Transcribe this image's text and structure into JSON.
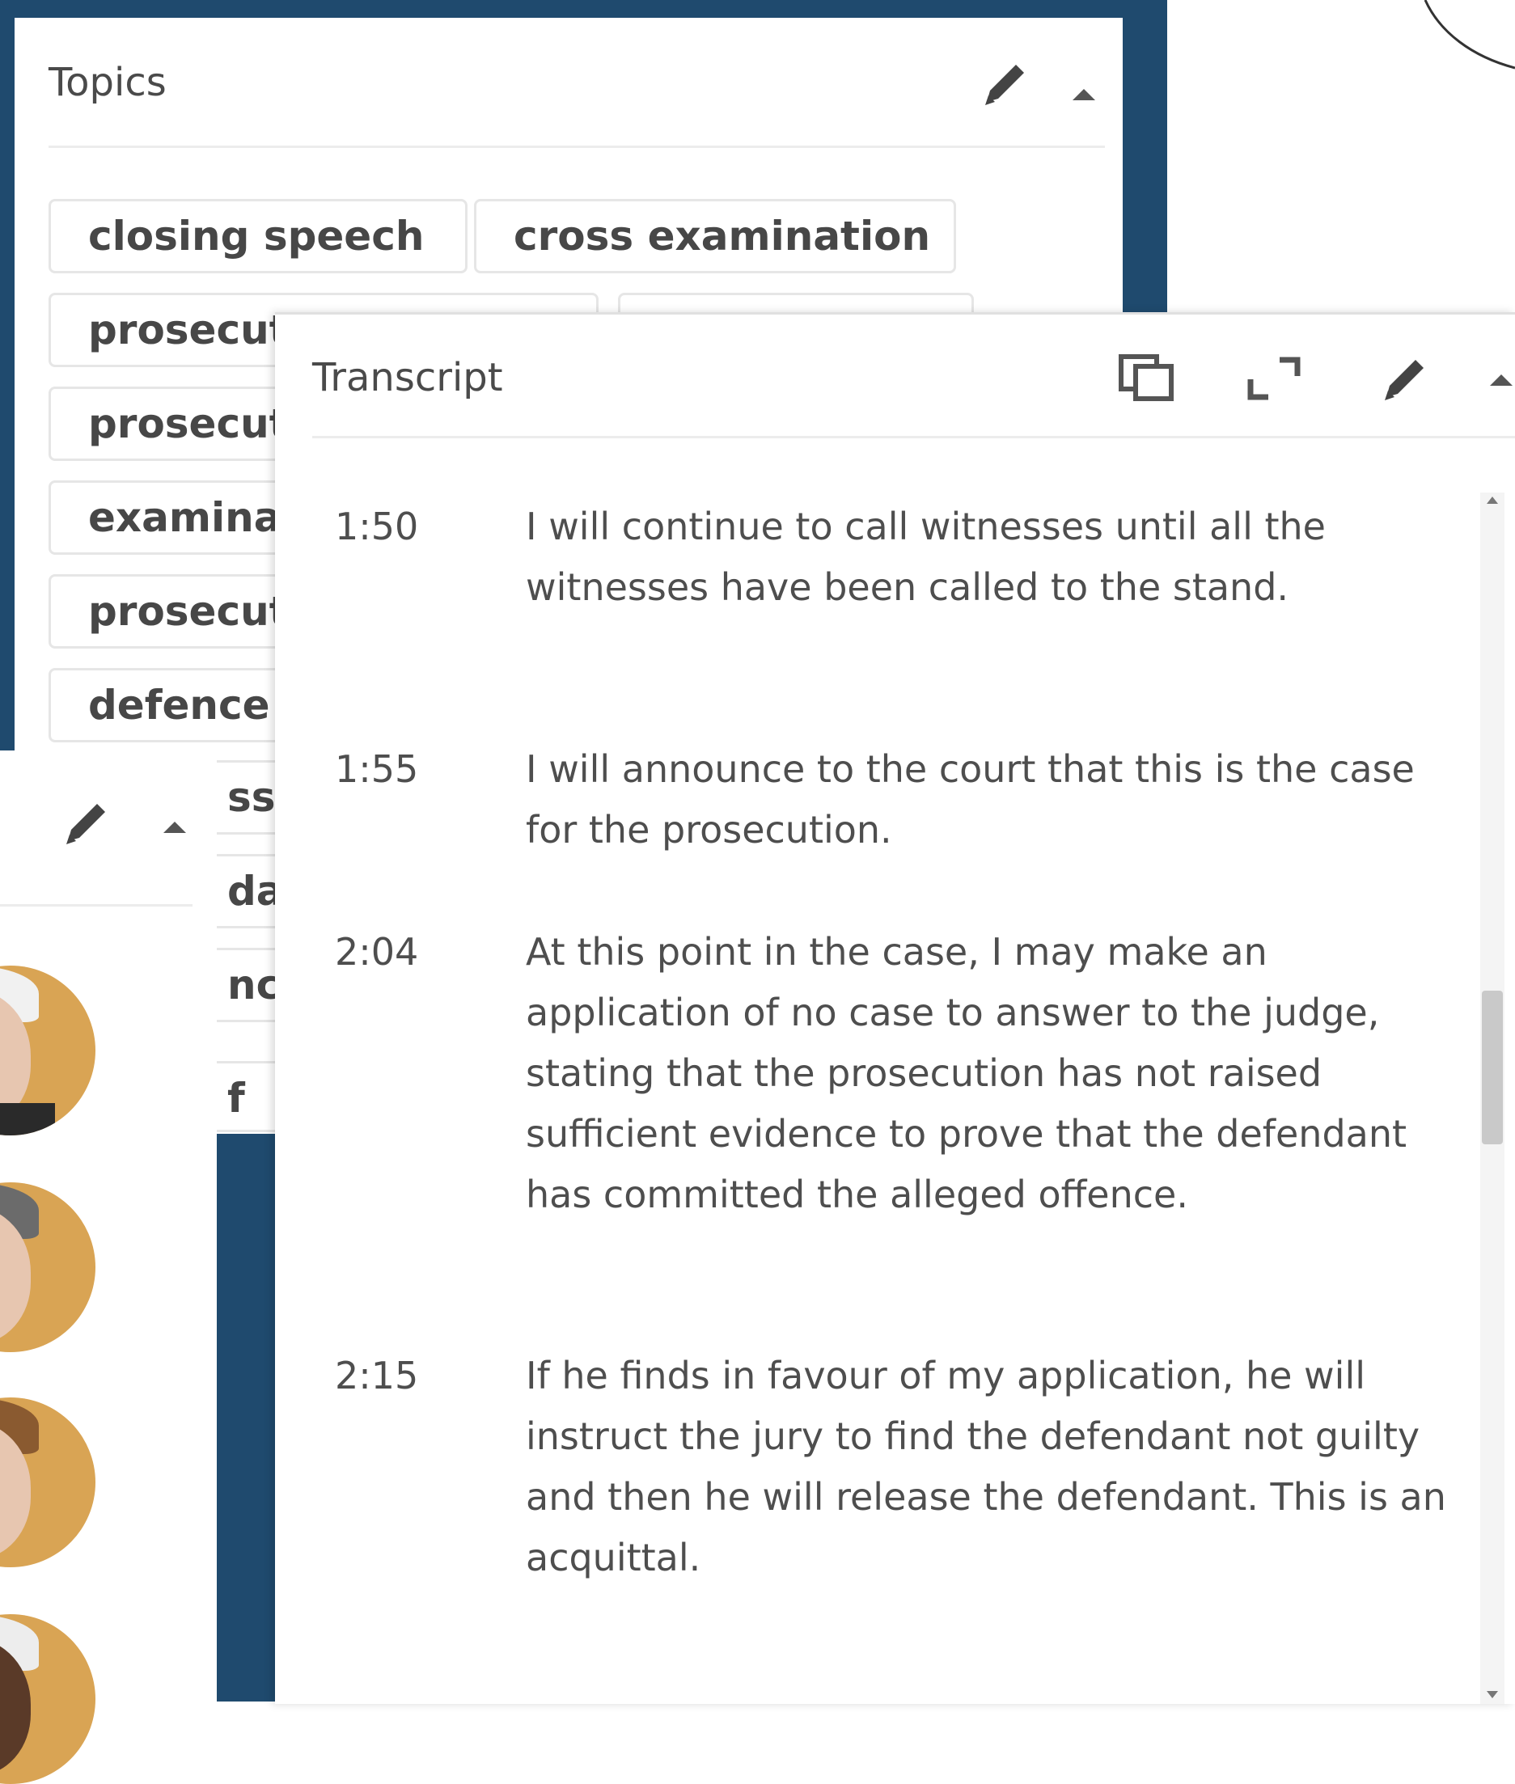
{
  "colors": {
    "frame": "#1f4a6e",
    "panel": "#ffffff",
    "chip_border": "#e6e6e6",
    "text": "#4a4a4a"
  },
  "topics_panel": {
    "title": "Topics",
    "icons": [
      "pencil-icon",
      "collapse-icon"
    ],
    "chips": [
      "closing speech",
      "cross examination",
      "prosecut",
      "prosecut",
      "examina",
      "prosecut",
      "defence",
      "sse",
      "dai",
      "nce",
      "f"
    ]
  },
  "speakers_panel": {
    "icons": [
      "pencil-icon",
      "collapse-icon"
    ]
  },
  "transcript_panel": {
    "title": "Transcript",
    "icons": [
      "copy-icon",
      "expand-icon",
      "pencil-icon",
      "collapse-icon"
    ],
    "segments": [
      {
        "time": "1:50",
        "text": "I will continue to call witnesses until all the witnesses have been called to the stand."
      },
      {
        "time": "1:55",
        "text": "I will announce to the court that this is the case for the prosecution."
      },
      {
        "time": "2:04",
        "text": "At this point in the case, I may make an application of no case to answer to the judge, stating that the prosecution has not raised sufficient evidence to prove that the defendant has committed the alleged offence."
      },
      {
        "time": "2:15",
        "text": "If he finds in favour of my application, he will instruct the jury to find the defendant not guilty and then he will release the defendant. This is an acquittal."
      }
    ]
  }
}
